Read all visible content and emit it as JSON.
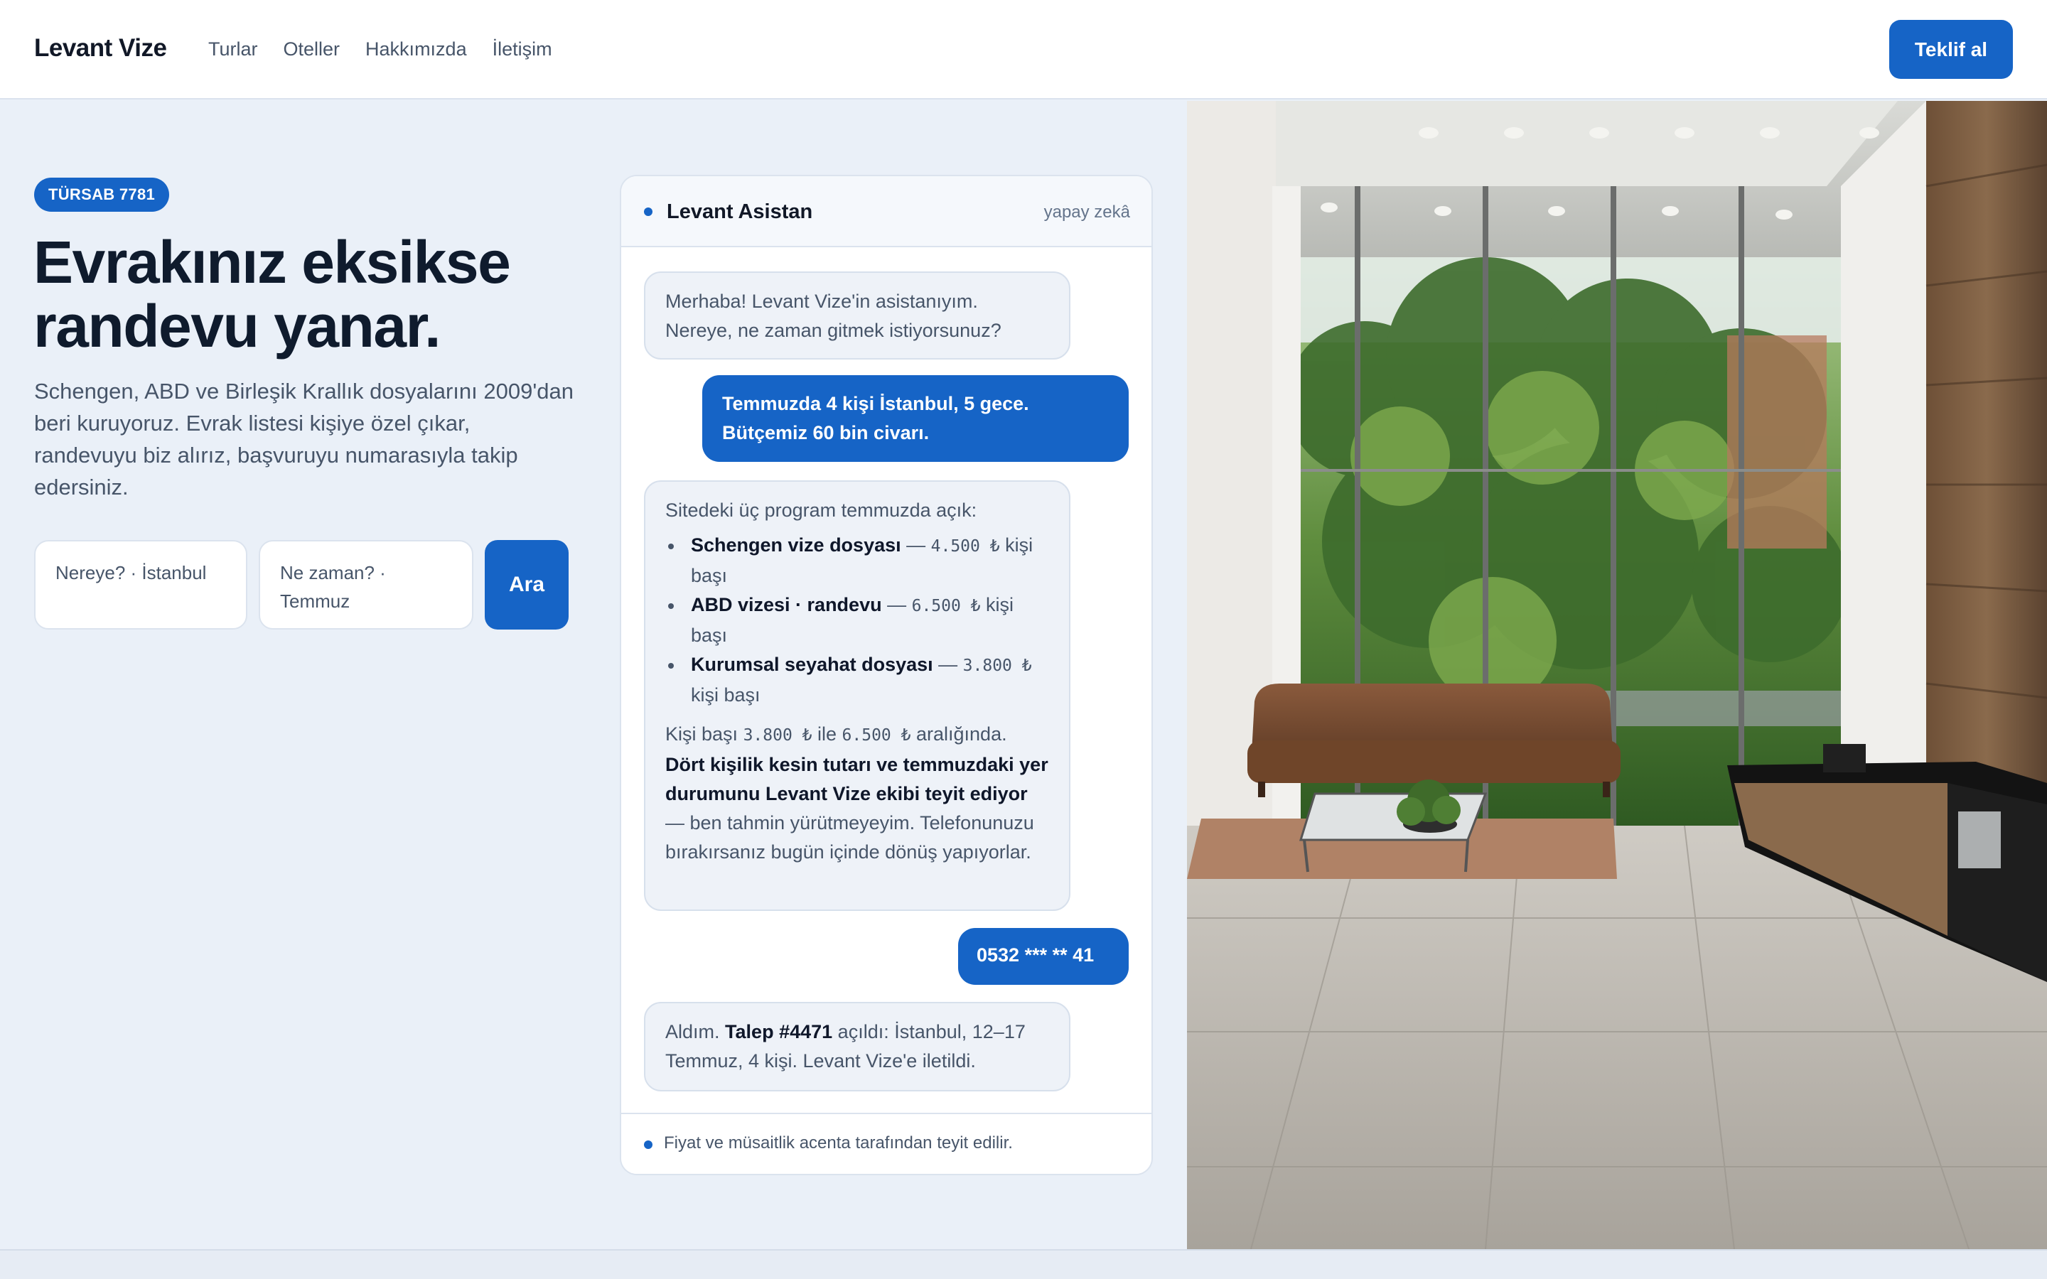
{
  "nav": {
    "brand": "Levant Vize",
    "links": [
      "Turlar",
      "Oteller",
      "Hakkımızda",
      "İletişim"
    ],
    "cta": "Teklif al"
  },
  "hero": {
    "badge": "TÜRSAB 7781",
    "headline_line1": "Evrakınız eksikse",
    "headline_line2": "randevu yanar.",
    "lead": "Schengen, ABD ve Birleşik Krallık dosyalarını 2009'dan beri kuruyoruz. Evrak listesi kişiye özel çıkar, randevuyu biz alırız, başvuruyu numarasıyla takip edersiniz.",
    "search": {
      "destination_placeholder": "Nereye? · İstanbul",
      "date_placeholder": "Ne zaman? · Temmuz",
      "button": "Ara"
    }
  },
  "chat": {
    "title": "Levant Asistan",
    "tag": "yapay zekâ",
    "greeting": "Merhaba! Levant Vize'in asistanıyım. Nereye, ne zaman gitmek istiyorsunuz?",
    "user_request": "Temmuzda 4 kişi İstanbul, 5 gece. Bütçemiz 60 bin civarı.",
    "programs_intro": "Sitedeki üç program temmuzda açık:",
    "programs": [
      {
        "name": "Schengen vize dosyası",
        "price": "4.500 ₺",
        "unit": "kişi başı"
      },
      {
        "name": "ABD vizesi · randevu",
        "price": "6.500 ₺",
        "unit": "kişi başı"
      },
      {
        "name": "Kurumsal seyahat dosyası",
        "price": "3.800 ₺",
        "unit": "kişi başı"
      }
    ],
    "range_prefix": "Kişi başı",
    "range_min": "3.800 ₺",
    "range_mid": "ile",
    "range_max": "6.500 ₺",
    "range_suffix": "aralığında.",
    "confirm_bold": "Dört kişilik kesin tutarı ve temmuzdaki yer durumunu Levant Vize ekibi teyit ediyor",
    "confirm_rest": "— ben tahmin yürütmeyeyim. Telefonunuzu bırakırsanız bugün içinde dönüş yapıyorlar.",
    "user_phone": "0532 *** ** 41",
    "ack_prefix": "Aldım.",
    "ack_bold": "Talep #4471",
    "ack_rest": "açıldı: İstanbul, 12–17 Temmuz, 4 kişi. Levant Vize'e iletildi.",
    "footer": "Fiyat ve müsaitlik acenta tarafından teyit edilir."
  },
  "colors": {
    "accent": "#1664c6",
    "page_bg": "#eaf0f8",
    "text_dark": "#0f172a",
    "text_muted": "#475569"
  }
}
